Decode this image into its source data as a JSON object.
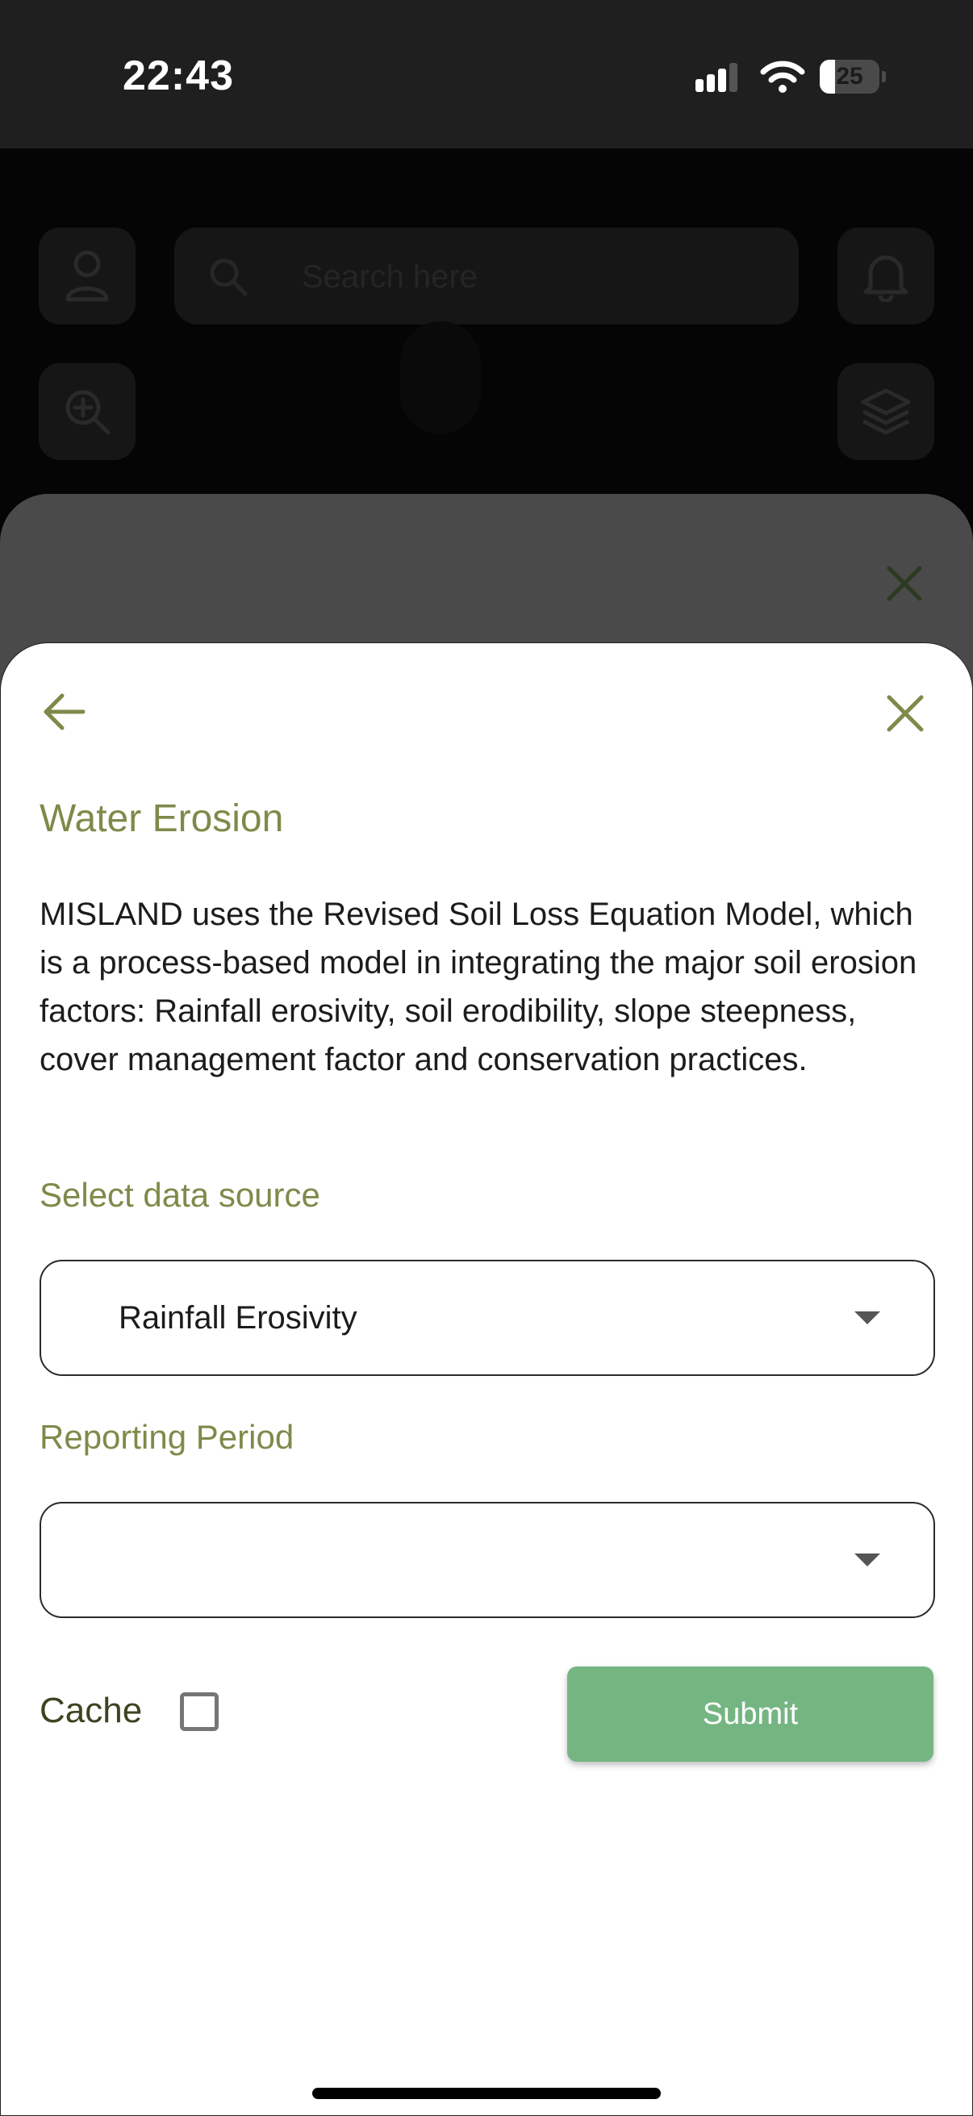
{
  "status_bar": {
    "time": "22:43",
    "battery_level": "25",
    "battery_fraction": 0.25,
    "icons": [
      "signal-icon",
      "wifi-icon",
      "battery-icon"
    ]
  },
  "map": {
    "search_placeholder": "Search here",
    "icons": [
      "user-icon",
      "search-icon",
      "bell-icon",
      "zoom-in-icon",
      "layers-icon"
    ]
  },
  "sheet": {
    "title": "Water Erosion",
    "description": "MISLAND uses the Revised Soil Loss Equation Model, which is a process-based model in integrating the major soil erosion factors: Rainfall erosivity, soil erodibility, slope steepness, cover management factor and conservation practices.",
    "data_source_label": "Select data source",
    "data_source_value": "Rainfall Erosivity",
    "reporting_period_label": "Reporting Period",
    "reporting_period_value": "",
    "cache_label": "Cache",
    "cache_checked": false,
    "submit_label": "Submit"
  },
  "colors": {
    "accent": "#7f8a4a",
    "submit": "#75b582",
    "sheet_bg": "#ffffff"
  }
}
